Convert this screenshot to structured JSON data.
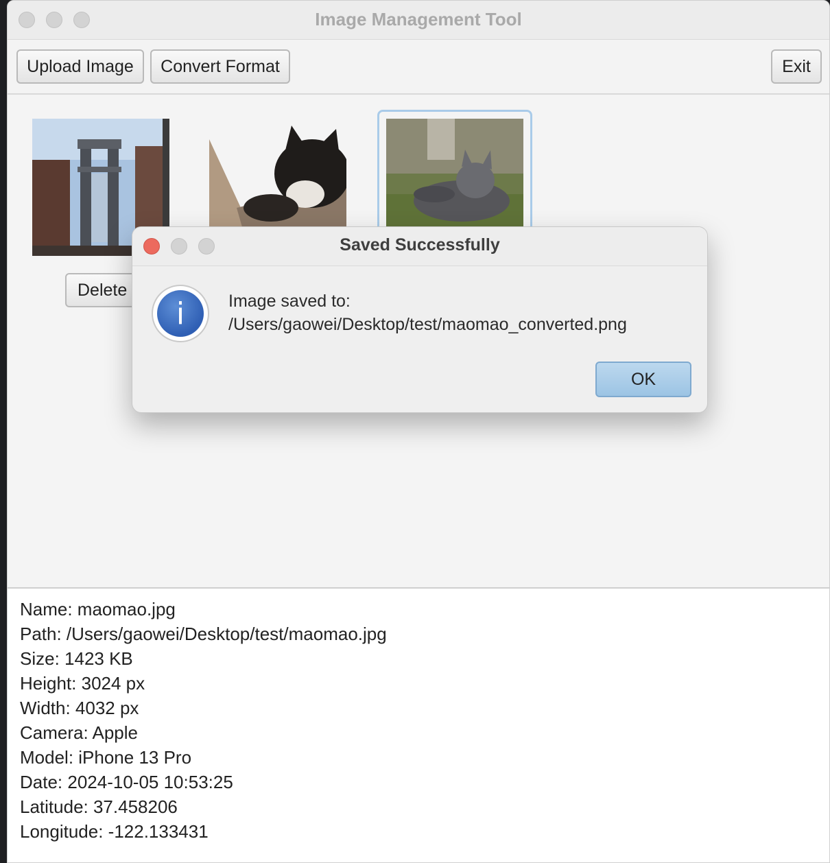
{
  "window": {
    "title": "Image Management Tool"
  },
  "toolbar": {
    "upload_label": "Upload Image",
    "convert_label": "Convert Format",
    "exit_label": "Exit"
  },
  "gallery": {
    "delete_label": "Delete",
    "thumbnails": [
      "bridge-photo",
      "black-cat-photo",
      "grey-cat-photo"
    ],
    "selected_index": 2
  },
  "info": {
    "lines": [
      "Name: maomao.jpg",
      "Path: /Users/gaowei/Desktop/test/maomao.jpg",
      "Size: 1423 KB",
      "Height: 3024 px",
      "Width: 4032 px",
      "Camera: Apple",
      "Model: iPhone 13 Pro",
      "Date: 2024-10-05 10:53:25",
      "Latitude: 37.458206",
      "Longitude: -122.133431"
    ]
  },
  "dialog": {
    "title": "Saved Successfully",
    "message_line1": "Image saved to:",
    "message_line2": "/Users/gaowei/Desktop/test/maomao_converted.png",
    "ok_label": "OK",
    "icon": "info-icon"
  },
  "colors": {
    "close_dot": "#ec6a5e",
    "inactive_dot": "#d3d3d3",
    "ok_button": "#9cc4e4",
    "selected_frame": "#a9cbe9"
  }
}
